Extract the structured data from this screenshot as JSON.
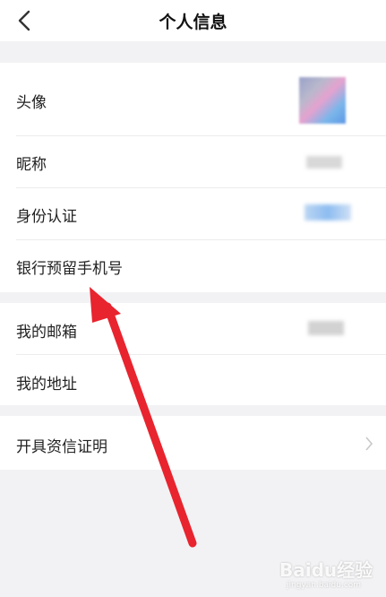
{
  "header": {
    "title": "个人信息"
  },
  "rows": [
    {
      "label": "头像"
    },
    {
      "label": "昵称"
    },
    {
      "label": "身份认证"
    },
    {
      "label": "银行预留手机号"
    },
    {
      "label": "我的邮箱"
    },
    {
      "label": "我的地址"
    },
    {
      "label": "开具资信证明"
    }
  ],
  "watermark": {
    "logo_text": "Baidu经验",
    "url_text": "jingyan.baidu.com"
  },
  "colors": {
    "annotation_arrow": "#e8242f",
    "background": "#f2f2f4"
  },
  "icons": {
    "back": "back-arrow-icon",
    "row_chevron": "chevron-right-icon"
  }
}
